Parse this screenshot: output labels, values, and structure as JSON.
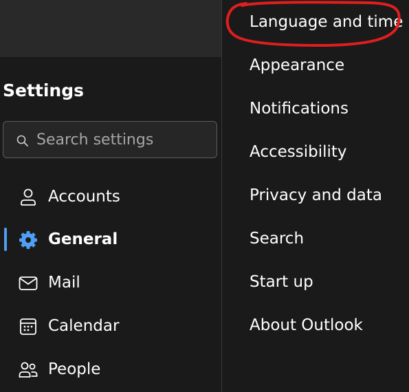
{
  "colors": {
    "accent": "#4f9ff5",
    "annotation": "#e01e1e",
    "text": "#ffffff",
    "placeholder": "#a6a6a6",
    "border": "#5c5c5c"
  },
  "sidebar": {
    "title": "Settings",
    "search": {
      "placeholder": "Search settings",
      "icon": "search-icon"
    },
    "items": [
      {
        "label": "Accounts",
        "icon": "person-icon",
        "selected": false
      },
      {
        "label": "General",
        "icon": "gear-icon",
        "selected": true
      },
      {
        "label": "Mail",
        "icon": "mail-icon",
        "selected": false
      },
      {
        "label": "Calendar",
        "icon": "calendar-icon",
        "selected": false
      },
      {
        "label": "People",
        "icon": "people-icon",
        "selected": false
      }
    ]
  },
  "general_menu": {
    "items": [
      {
        "label": "Language and time",
        "highlighted": true
      },
      {
        "label": "Appearance"
      },
      {
        "label": "Notifications"
      },
      {
        "label": "Accessibility"
      },
      {
        "label": "Privacy and data"
      },
      {
        "label": "Search"
      },
      {
        "label": "Start up"
      },
      {
        "label": "About Outlook"
      }
    ]
  }
}
